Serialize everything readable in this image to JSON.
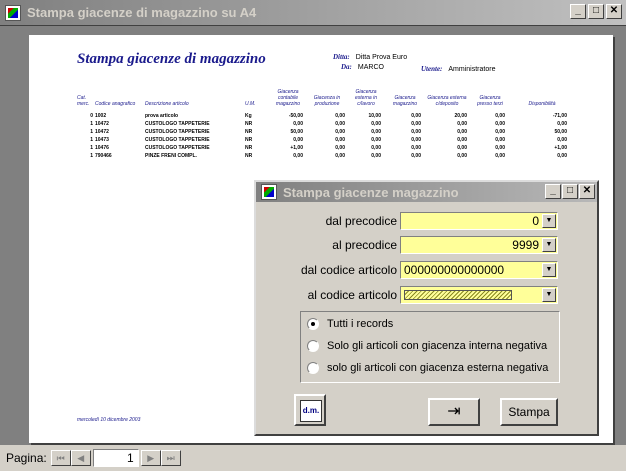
{
  "window": {
    "title": "Stampa giacenze di magazzino su A4",
    "buttons": [
      "_",
      "□",
      "✕"
    ]
  },
  "report": {
    "title": "Stampa giacenze di magazzino",
    "ditta_label": "Ditta:",
    "ditta_value": "Ditta Prova Euro",
    "da_label": "Da:",
    "da_value": "MARCO",
    "utente_label": "Utente:",
    "utente_value": "Amministratore",
    "columns": [
      "Cat. merc.",
      "Codice anagrafico",
      "Descrizione articolo",
      "U.M.",
      "Giacenza contabile magazzino",
      "Giacenza in produzione",
      "Giacenza esterna in c/lavoro",
      "Giacenza magazzino",
      "Giacenza esterna c/deposito",
      "Giacenza presso terzi",
      "Disponibilità"
    ],
    "rows": [
      [
        "0",
        "1002",
        "prova articolo",
        "Kg",
        "-50,00",
        "0,00",
        "10,00",
        "0,00",
        "20,00",
        "0,00",
        "-71,00"
      ],
      [
        "1",
        "10472",
        "CUSTOLOGO TAPPETERIE",
        "NR",
        "0,00",
        "0,00",
        "0,00",
        "0,00",
        "0,00",
        "0,00",
        "0,00"
      ],
      [
        "1",
        "10472",
        "CUSTOLOGO TAPPETERIE",
        "NR",
        "50,00",
        "0,00",
        "0,00",
        "0,00",
        "0,00",
        "0,00",
        "50,00"
      ],
      [
        "1",
        "10473",
        "CUSTOLOGO TAPPETERIE",
        "NR",
        "0,00",
        "0,00",
        "0,00",
        "0,00",
        "0,00",
        "0,00",
        "0,00"
      ],
      [
        "1",
        "10476",
        "CUSTOLOGO TAPPETERIE",
        "NR",
        "+1,00",
        "0,00",
        "0,00",
        "0,00",
        "0,00",
        "0,00",
        "+1,00"
      ],
      [
        "1",
        "790466",
        "PINZE FRENI COMPL.",
        "NR",
        "0,00",
        "0,00",
        "0,00",
        "0,00",
        "0,00",
        "0,00",
        "0,00"
      ]
    ],
    "footer": "mercoledì 10 dicembre 2003"
  },
  "statusbar": {
    "page_label": "Pagina:",
    "page_value": "1",
    "nav": [
      "⏮",
      "◀",
      "▶",
      "⏭"
    ]
  },
  "dialog": {
    "title": "Stampa giacenze magazzino",
    "fields": [
      {
        "label": "dal precodice",
        "value": "0"
      },
      {
        "label": "al precodice",
        "value": "9999"
      },
      {
        "label": "dal codice articolo",
        "value": "000000000000000"
      },
      {
        "label": "al codice articolo",
        "value": ""
      }
    ],
    "options": [
      "Tutti i records",
      "Solo gli articoli con giacenza interna negativa",
      "solo gli articoli con giacenza esterna negativa"
    ],
    "selected_option": 0,
    "dm_icon_text": "d.m.",
    "exit_icon": "⇥",
    "print_button": "Stampa"
  },
  "colors": {
    "title_text": "#1a1a8c",
    "field_bg": "#ffff99",
    "titlebar": "#808080"
  }
}
